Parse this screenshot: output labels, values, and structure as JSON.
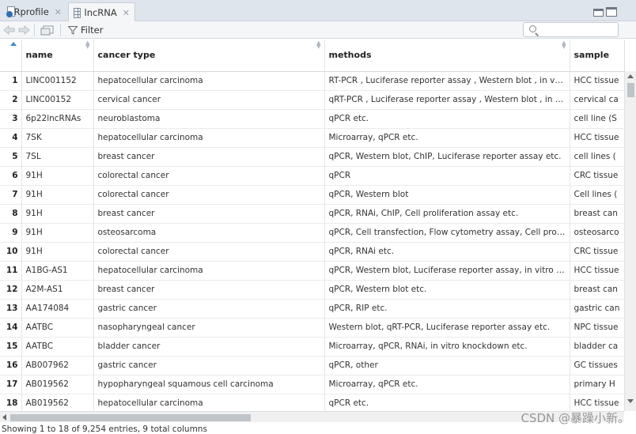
{
  "tabs": [
    {
      "label": ".Rprofile",
      "icon": "r-file-icon"
    },
    {
      "label": "lncRNA",
      "icon": "table-grid-icon"
    }
  ],
  "toolbar": {
    "filter_label": "Filter",
    "search_placeholder": ""
  },
  "table": {
    "columns": [
      "name",
      "cancer type",
      "methods",
      "sample"
    ],
    "rows": [
      {
        "n": "1",
        "name": "LINC001152",
        "cancer": "hepatocellular carcinoma",
        "methods": "RT-PCR , Luciferase reporter assay , Western blot , in vitro kn...",
        "sample": "HCC tissue"
      },
      {
        "n": "2",
        "name": "LINC00152",
        "cancer": "cervical cancer",
        "methods": "qRT-PCR , Luciferase reporter assay , Western blot , in vitro k...",
        "sample": "cervical ca"
      },
      {
        "n": "3",
        "name": "6p22lncRNAs",
        "cancer": "neuroblastoma",
        "methods": "qPCR etc.",
        "sample": "cell line (S"
      },
      {
        "n": "4",
        "name": "7SK",
        "cancer": "hepatocellular carcinoma",
        "methods": "Microarray, qPCR etc.",
        "sample": "HCC tissue"
      },
      {
        "n": "5",
        "name": "7SL",
        "cancer": "breast cancer",
        "methods": "qPCR, Western blot, ChIP, Luciferase reporter assay etc.",
        "sample": "cell lines ("
      },
      {
        "n": "6",
        "name": "91H",
        "cancer": "colorectal cancer",
        "methods": "qPCR",
        "sample": "CRC tissue"
      },
      {
        "n": "7",
        "name": "91H",
        "cancer": "colorectal cancer",
        "methods": "qPCR, Western blot",
        "sample": "Cell lines ("
      },
      {
        "n": "8",
        "name": "91H",
        "cancer": "breast cancer",
        "methods": "qPCR, RNAi, ChIP, Cell proliferation assay etc.",
        "sample": "breast can"
      },
      {
        "n": "9",
        "name": "91H",
        "cancer": "osteosarcoma",
        "methods": "qPCR, Cell transfection, Flow cytometry assay, Cell proliferati...",
        "sample": "osteosarco"
      },
      {
        "n": "10",
        "name": "91H",
        "cancer": "colorectal cancer",
        "methods": "qPCR, RNAi etc.",
        "sample": "CRC tissue"
      },
      {
        "n": "11",
        "name": "A1BG-AS1",
        "cancer": "hepatocellular carcinoma",
        "methods": "qPCR, Western blot, Luciferase reporter assay, in vitro knock...",
        "sample": "HCC tissue"
      },
      {
        "n": "12",
        "name": "A2M-AS1",
        "cancer": "breast cancer",
        "methods": "qPCR, Western blot etc.",
        "sample": "breast can"
      },
      {
        "n": "13",
        "name": "AA174084",
        "cancer": "gastric cancer",
        "methods": "qPCR, RIP etc.",
        "sample": "gastric can"
      },
      {
        "n": "14",
        "name": "AATBC",
        "cancer": "nasopharyngeal cancer",
        "methods": "Western blot, qRT-PCR, Luciferase reporter assay etc.",
        "sample": "NPC tissue"
      },
      {
        "n": "15",
        "name": "AATBC",
        "cancer": "bladder cancer",
        "methods": "Microarray, qPCR, RNAi, in vitro knockdown etc.",
        "sample": "bladder ca"
      },
      {
        "n": "16",
        "name": "AB007962",
        "cancer": "gastric cancer",
        "methods": "qPCR, other",
        "sample": "GC tissues"
      },
      {
        "n": "17",
        "name": "AB019562",
        "cancer": "hypopharyngeal squamous cell carcinoma",
        "methods": "Microarray, qPCR etc.",
        "sample": "primary H"
      },
      {
        "n": "18",
        "name": "AB019562",
        "cancer": "hepatocellular carcinoma",
        "methods": "qPCR etc.",
        "sample": "HCC tissue"
      }
    ]
  },
  "status": "Showing 1 to 18 of 9,254 entries, 9 total columns",
  "watermark": "CSDN @暴躁小新。"
}
